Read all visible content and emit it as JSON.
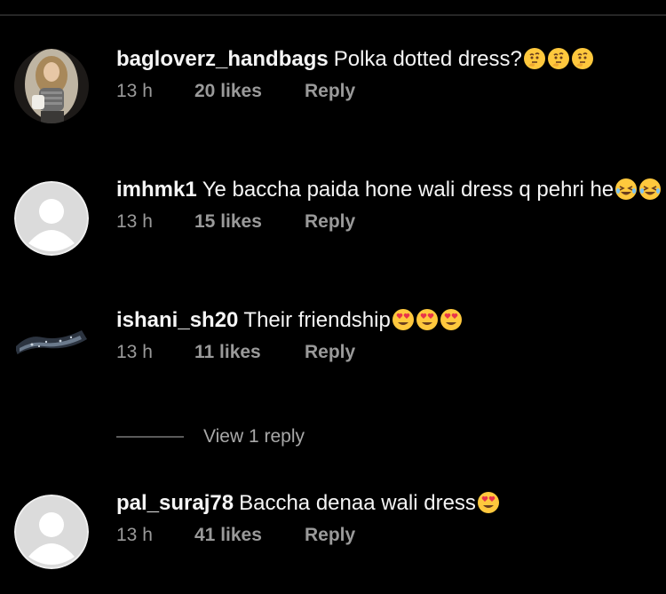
{
  "colors": {
    "background": "#000000",
    "text": "#f5f5f5",
    "meta": "#9a9a9a",
    "divider": "#262626",
    "emoji": "#ffc83d"
  },
  "comments": [
    {
      "username": "bagloverz_handbags",
      "text": "Polka dotted dress?",
      "emojis": [
        "thinking-face-icon",
        "thinking-face-icon",
        "thinking-face-icon"
      ],
      "time": "13 h",
      "likes": "20 likes",
      "reply_label": "Reply",
      "avatar": "photo-avatar"
    },
    {
      "username": "imhmk1",
      "text": "Ye baccha paida hone wali dress q pehri he",
      "emojis": [
        "laughing-face-icon",
        "laughing-face-icon"
      ],
      "time": "13 h",
      "likes": "15 likes",
      "reply_label": "Reply",
      "avatar": "default-avatar"
    },
    {
      "username": "ishani_sh20",
      "text": "Their friendship",
      "emojis": [
        "heart-eyes-icon",
        "heart-eyes-icon",
        "heart-eyes-icon"
      ],
      "time": "13 h",
      "likes": "11 likes",
      "reply_label": "Reply",
      "avatar": "dark-photo-avatar"
    },
    {
      "username": "pal_suraj78",
      "text": "Baccha denaa wali dress",
      "emojis": [
        "heart-eyes-icon"
      ],
      "time": "13 h",
      "likes": "41 likes",
      "reply_label": "Reply",
      "avatar": "default-avatar"
    }
  ],
  "view_replies": {
    "label": "View 1 reply"
  }
}
